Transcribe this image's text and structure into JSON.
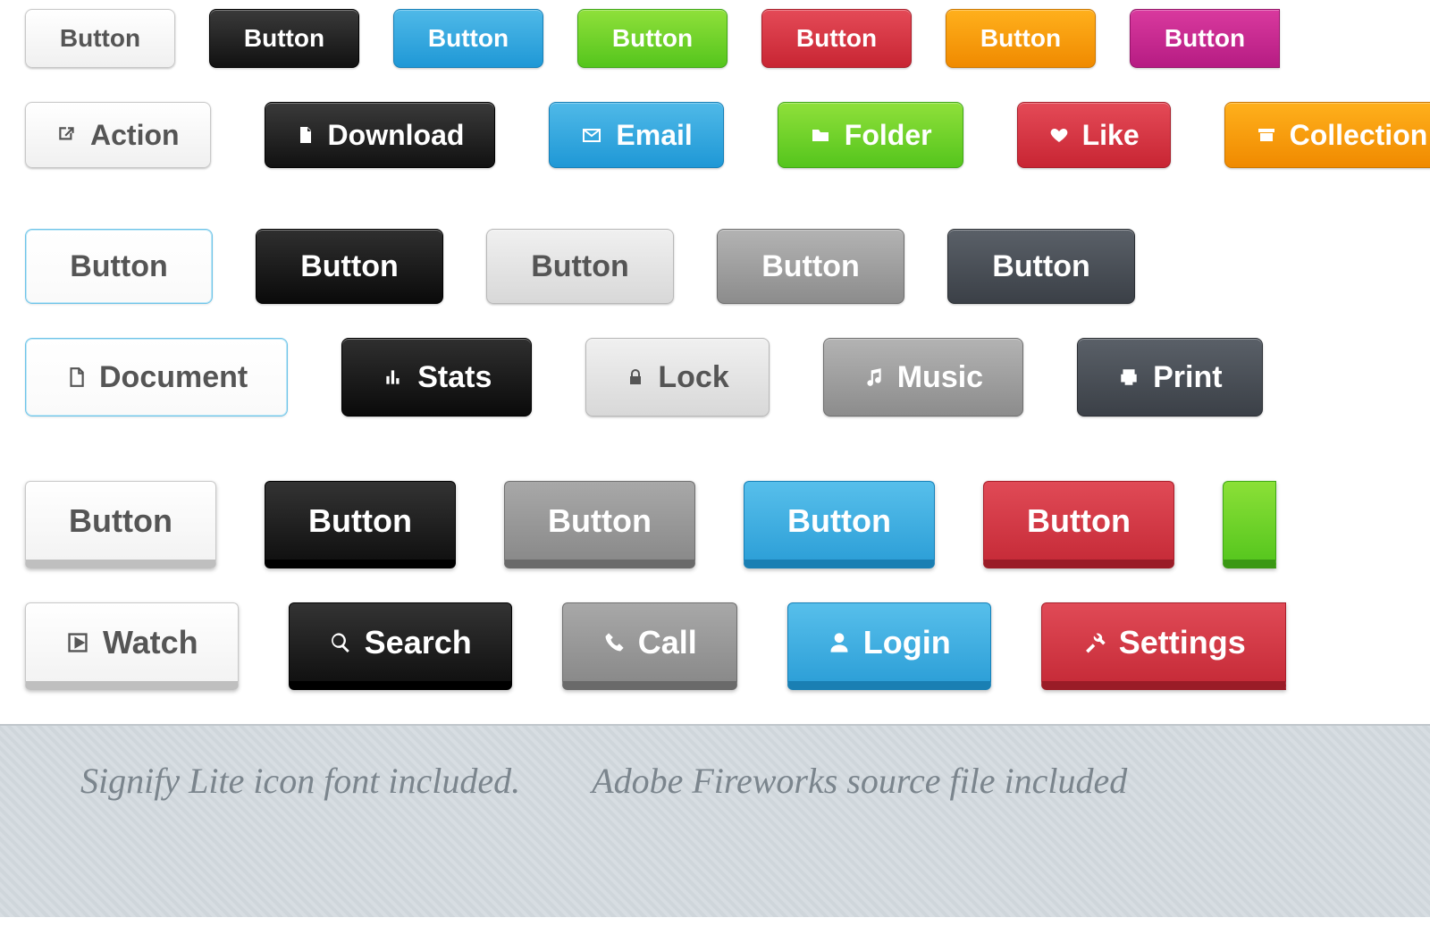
{
  "generic_label": "Button",
  "row2": {
    "action": {
      "label": "Action",
      "icon": "external-link-icon"
    },
    "download": {
      "label": "Download",
      "icon": "file-icon"
    },
    "email": {
      "label": "Email",
      "icon": "mail-icon"
    },
    "folder": {
      "label": "Folder",
      "icon": "folder-icon"
    },
    "like": {
      "label": "Like",
      "icon": "heart-icon"
    },
    "collection": {
      "label": "Collection",
      "icon": "archive-icon"
    }
  },
  "row4": {
    "document": {
      "label": "Document",
      "icon": "document-icon"
    },
    "stats": {
      "label": "Stats",
      "icon": "bar-chart-icon"
    },
    "lock": {
      "label": "Lock",
      "icon": "lock-icon"
    },
    "music": {
      "label": "Music",
      "icon": "music-note-icon"
    },
    "print": {
      "label": "Print",
      "icon": "printer-icon"
    }
  },
  "row6": {
    "watch": {
      "label": "Watch",
      "icon": "play-box-icon"
    },
    "search": {
      "label": "Search",
      "icon": "search-icon"
    },
    "call": {
      "label": "Call",
      "icon": "phone-icon"
    },
    "login": {
      "label": "Login",
      "icon": "user-icon"
    },
    "settings": {
      "label": "Settings",
      "icon": "tools-icon"
    }
  },
  "footer": {
    "left": "Signify Lite icon font included.",
    "right": "Adobe Fireworks source file included"
  },
  "colors": {
    "white": "#f5f5f5",
    "black": "#1a1a1a",
    "blue": "#2ea0d8",
    "green": "#5cc720",
    "red": "#cc2f3c",
    "orange": "#f59a0b",
    "magenta": "#c22890",
    "ltgray": "#e0e0e0",
    "mdgray": "#969696",
    "dkgray": "#474c53"
  }
}
